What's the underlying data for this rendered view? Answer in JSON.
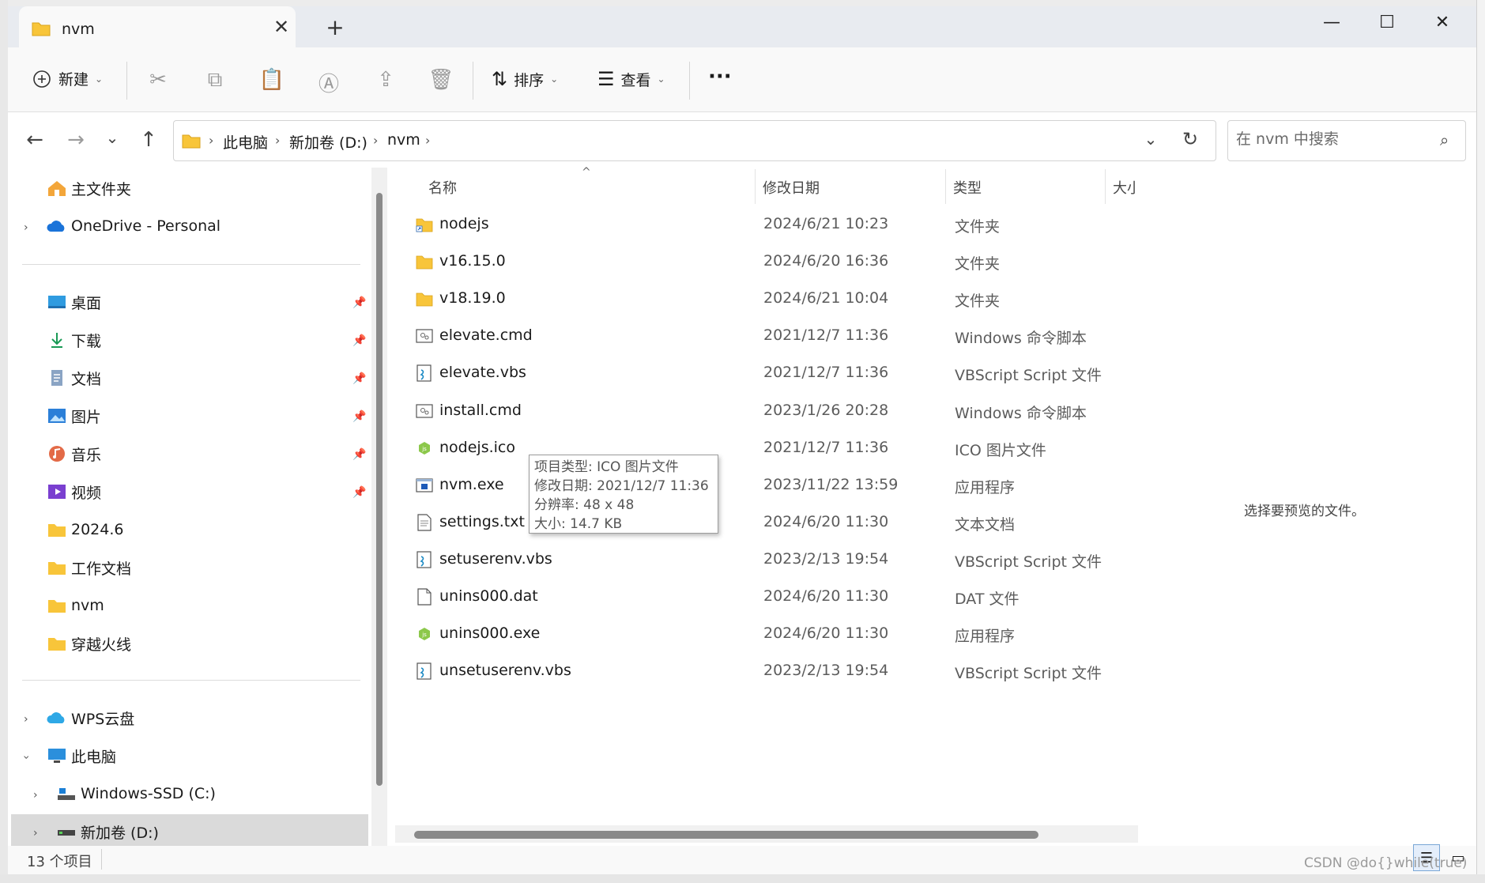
{
  "tab": {
    "title": "nvm",
    "close": "✕",
    "new": "+"
  },
  "window": {
    "minimize": "—",
    "maximize": "☐",
    "close": "✕"
  },
  "toolbar": {
    "new_label": "新建",
    "sort_label": "排序",
    "view_label": "查看",
    "more": "···"
  },
  "address": {
    "crumbs": [
      "此电脑",
      "新加卷 (D:)",
      "nvm"
    ],
    "sep": "›"
  },
  "search": {
    "placeholder": "在 nvm 中搜索"
  },
  "sidebar": {
    "home": "主文件夹",
    "onedrive": "OneDrive - Personal",
    "quick": [
      "桌面",
      "下载",
      "文档",
      "图片",
      "音乐",
      "视频",
      "2024.6",
      "工作文档",
      "nvm",
      "穿越火线"
    ],
    "wps": "WPS云盘",
    "thispc": "此电脑",
    "drive_c": "Windows-SSD (C:)",
    "drive_d": "新加卷 (D:)"
  },
  "columns": {
    "name": "名称",
    "date": "修改日期",
    "type": "类型",
    "size": "大小"
  },
  "files": [
    {
      "name": "nodejs",
      "date": "2024/6/21 10:23",
      "type": "文件夹",
      "icon": "folder-link"
    },
    {
      "name": "v16.15.0",
      "date": "2024/6/20 16:36",
      "type": "文件夹",
      "icon": "folder"
    },
    {
      "name": "v18.19.0",
      "date": "2024/6/21 10:04",
      "type": "文件夹",
      "icon": "folder"
    },
    {
      "name": "elevate.cmd",
      "date": "2021/12/7 11:36",
      "type": "Windows 命令脚本",
      "icon": "cmd"
    },
    {
      "name": "elevate.vbs",
      "date": "2021/12/7 11:36",
      "type": "VBScript Script 文件",
      "icon": "vbs"
    },
    {
      "name": "install.cmd",
      "date": "2023/1/26 20:28",
      "type": "Windows 命令脚本",
      "icon": "cmd"
    },
    {
      "name": "nodejs.ico",
      "date": "2021/12/7 11:36",
      "type": "ICO 图片文件",
      "icon": "node"
    },
    {
      "name": "nvm.exe",
      "date": "2023/11/22 13:59",
      "type": "应用程序",
      "icon": "exe"
    },
    {
      "name": "settings.txt",
      "date": "2024/6/20 11:30",
      "type": "文本文档",
      "icon": "txt"
    },
    {
      "name": "setuserenv.vbs",
      "date": "2023/2/13 19:54",
      "type": "VBScript Script 文件",
      "icon": "vbs"
    },
    {
      "name": "unins000.dat",
      "date": "2024/6/20 11:30",
      "type": "DAT 文件",
      "icon": "dat"
    },
    {
      "name": "unins000.exe",
      "date": "2024/6/20 11:30",
      "type": "应用程序",
      "icon": "node"
    },
    {
      "name": "unsetuserenv.vbs",
      "date": "2023/2/13 19:54",
      "type": "VBScript Script 文件",
      "icon": "vbs"
    }
  ],
  "tooltip": {
    "type": "项目类型: ICO 图片文件",
    "date": "修改日期: 2021/12/7 11:36",
    "res": "分辨率: 48 x 48",
    "size": "大小: 14.7 KB"
  },
  "preview": {
    "text": "选择要预览的文件。"
  },
  "status": {
    "count": "13 个项目"
  },
  "watermark": "CSDN @do{}while(true)",
  "colors": {
    "folder": "#f8c53a",
    "accent": "#0067c0",
    "selected": "#dadada"
  }
}
